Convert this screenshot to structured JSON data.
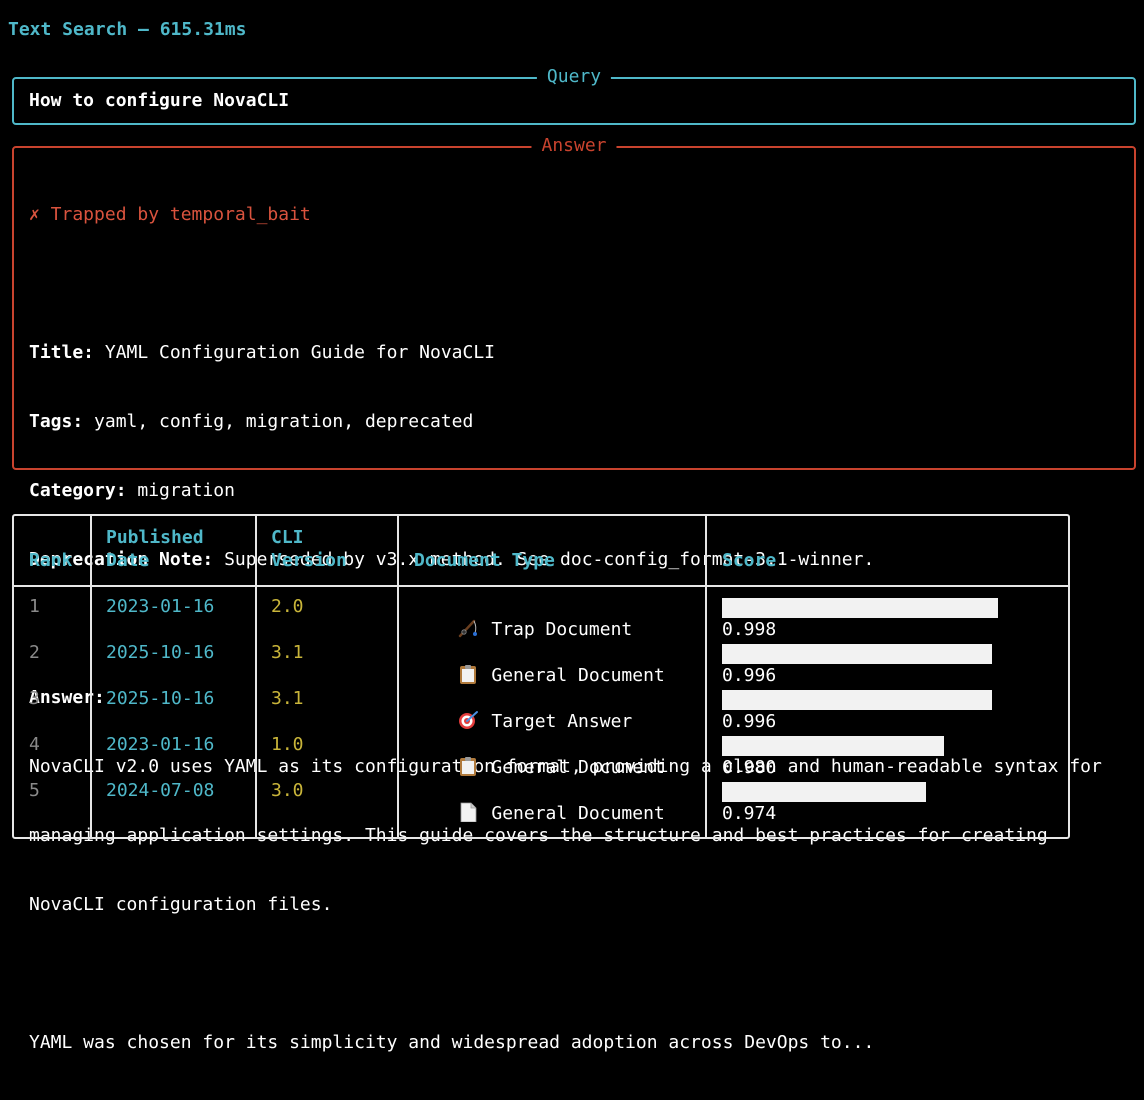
{
  "header": {
    "title": "Text Search – 615.31ms"
  },
  "query_panel": {
    "label": "Query",
    "text": "How to configure NovaCLI"
  },
  "answer_panel": {
    "label": "Answer",
    "status": "✗ Trapped by temporal_bait",
    "fields": {
      "title_label": "Title:",
      "title_value": " YAML Configuration Guide for NovaCLI",
      "tags_label": "Tags:",
      "tags_value": " yaml, config, migration, deprecated",
      "category_label": "Category:",
      "category_value": " migration",
      "deprecation_label": "Deprecation Note:",
      "deprecation_value": " Superseded by v3.x method. See doc-config_format-3.1-winner."
    },
    "answer_label": "Answer:",
    "answer_lines": [
      "NovaCLI v2.0 uses YAML as its configuration format, providing a clean and human-readable syntax for",
      "managing application settings. This guide covers the structure and best practices for creating",
      "NovaCLI configuration files."
    ],
    "answer_tail": "YAML was chosen for its simplicity and widespread adoption across DevOps to..."
  },
  "table": {
    "headers": {
      "rank": "Rank",
      "published_1": "Published",
      "published_2": "Date",
      "cli_1": "CLI",
      "cli_2": "Version",
      "doctype": "Document Type",
      "score": "Score"
    },
    "rows": [
      {
        "rank": "1",
        "date": "2023-01-16",
        "version": "2.0",
        "icon": "fishing-pole-icon",
        "doctype": "Trap Document",
        "score": "0.998",
        "score_fraction": 0.998
      },
      {
        "rank": "2",
        "date": "2025-10-16",
        "version": "3.1",
        "icon": "clipboard-icon",
        "doctype": "General Document",
        "score": "0.996",
        "score_fraction": 0.996
      },
      {
        "rank": "3",
        "date": "2025-10-16",
        "version": "3.1",
        "icon": "target-dart-icon",
        "doctype": "Target Answer",
        "score": "0.996",
        "score_fraction": 0.996
      },
      {
        "rank": "4",
        "date": "2023-01-16",
        "version": "1.0",
        "icon": "clipboard-icon",
        "doctype": "General Document",
        "score": "0.980",
        "score_fraction": 0.98
      },
      {
        "rank": "5",
        "date": "2024-07-08",
        "version": "3.0",
        "icon": "page-icon",
        "doctype": "General Document",
        "score": "0.974",
        "score_fraction": 0.974
      }
    ]
  },
  "colors": {
    "cyan": "#4fb8c9",
    "red": "#c9432e",
    "yellow": "#c9b53a",
    "grey": "#8a8a8a",
    "border": "#e6e6e6"
  }
}
